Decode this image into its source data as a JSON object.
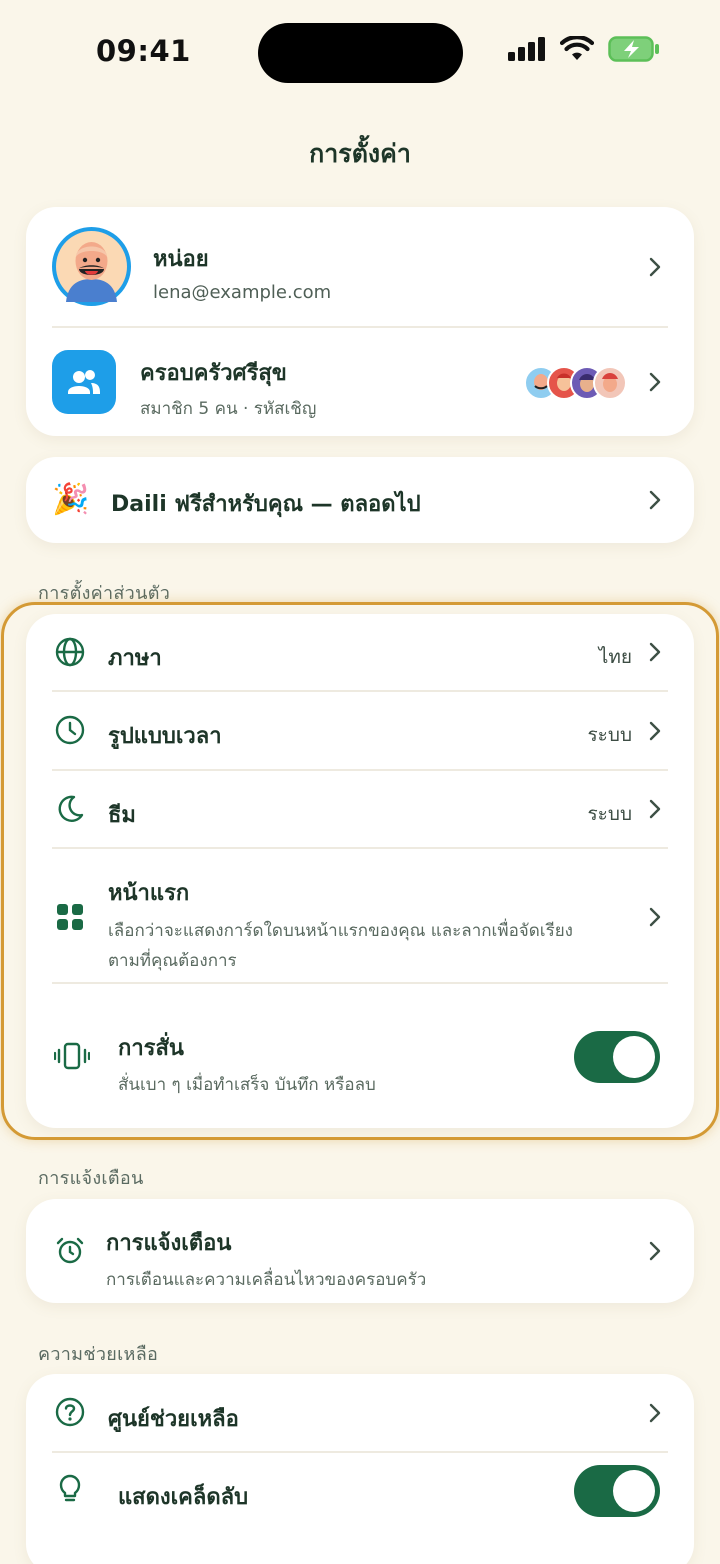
{
  "status_bar": {
    "time": "09:41"
  },
  "page_title": "การตั้งค่า",
  "profile": {
    "name": "หน่อย",
    "email": "lena@example.com"
  },
  "family": {
    "name": "ครอบครัวศรีสุข",
    "subtitle": "สมาชิก 5 คน · รหัสเชิญ"
  },
  "promo": {
    "emoji": "🎉",
    "label": "Daili ฟรีสำหรับคุณ — ตลอดไป"
  },
  "personal": {
    "section_label": "การตั้งค่าส่วนตัว",
    "language": {
      "label": "ภาษา",
      "value": "ไทย"
    },
    "time_format": {
      "label": "รูปแบบเวลา",
      "value": "ระบบ"
    },
    "theme": {
      "label": "ธีม",
      "value": "ระบบ"
    },
    "home": {
      "label": "หน้าแรก",
      "line1": "เลือกว่าจะแสดงการ์ดใดบนหน้าแรกของคุณ และลากเพื่อจัดเรียง",
      "line2": "ตามที่คุณต้องการ"
    },
    "haptics": {
      "label": "การสั่น",
      "sub": "สั่นเบา ๆ เมื่อทำเสร็จ บันทึก หรือลบ",
      "enabled": true
    }
  },
  "notifications": {
    "section_label": "การแจ้งเตือน",
    "item": {
      "label": "การแจ้งเตือน",
      "sub": "การเตือนและความเคลื่อนไหวของครอบครัว"
    }
  },
  "help": {
    "section_label": "ความช่วยเหลือ",
    "help_center": {
      "label": "ศูนย์ช่วยเหลือ"
    },
    "tips": {
      "label": "แสดงเคล็ดลับ",
      "enabled": true
    }
  },
  "colors": {
    "accent": "#1a6a45",
    "highlight": "#d49a35",
    "background": "#faf6ea",
    "family_icon_bg": "#1e9ee8"
  }
}
